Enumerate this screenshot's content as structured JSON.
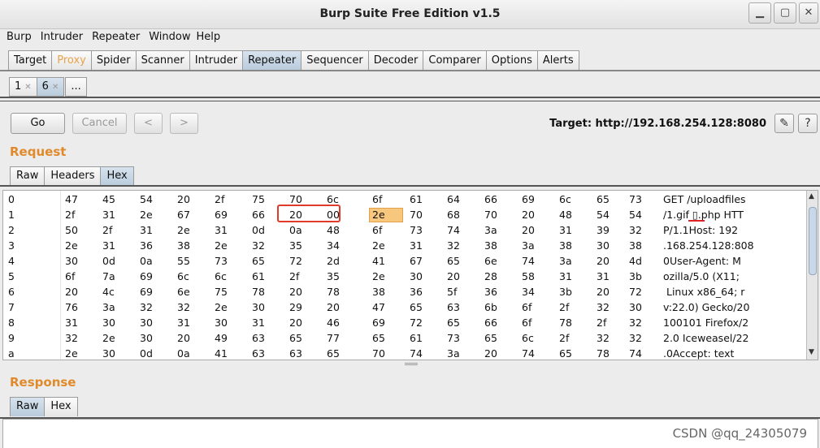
{
  "window": {
    "title": "Burp Suite Free Edition v1.5"
  },
  "menu": [
    "Burp",
    "Intruder",
    "Repeater",
    "Window",
    "Help"
  ],
  "main_tabs": [
    "Target",
    "Proxy",
    "Spider",
    "Scanner",
    "Intruder",
    "Repeater",
    "Sequencer",
    "Decoder",
    "Comparer",
    "Options",
    "Alerts"
  ],
  "sub_tabs": {
    "tab1": "1",
    "tab2": "6",
    "more": "..."
  },
  "toolbar": {
    "go": "Go",
    "cancel": "Cancel",
    "prev": "<",
    "next": ">",
    "target": "Target: http://192.168.254.128:8080",
    "help": "?"
  },
  "request": {
    "title": "Request",
    "view_tabs": [
      "Raw",
      "Headers",
      "Hex"
    ],
    "rows": [
      {
        "offset": "0",
        "hex": [
          "47",
          "45",
          "54",
          "20",
          "2f",
          "75",
          "70",
          "6c",
          "6f",
          "61",
          "64",
          "66",
          "69",
          "6c",
          "65",
          "73"
        ],
        "ascii": "GET /uploadfiles"
      },
      {
        "offset": "1",
        "hex": [
          "2f",
          "31",
          "2e",
          "67",
          "69",
          "66",
          "20",
          "00",
          "2e",
          "70",
          "68",
          "70",
          "20",
          "48",
          "54",
          "54"
        ],
        "ascii": "/1.gif ▯.php HTT"
      },
      {
        "offset": "2",
        "hex": [
          "50",
          "2f",
          "31",
          "2e",
          "31",
          "0d",
          "0a",
          "48",
          "6f",
          "73",
          "74",
          "3a",
          "20",
          "31",
          "39",
          "32"
        ],
        "ascii": "P/1.1Host: 192"
      },
      {
        "offset": "3",
        "hex": [
          "2e",
          "31",
          "36",
          "38",
          "2e",
          "32",
          "35",
          "34",
          "2e",
          "31",
          "32",
          "38",
          "3a",
          "38",
          "30",
          "38"
        ],
        "ascii": ".168.254.128:808"
      },
      {
        "offset": "4",
        "hex": [
          "30",
          "0d",
          "0a",
          "55",
          "73",
          "65",
          "72",
          "2d",
          "41",
          "67",
          "65",
          "6e",
          "74",
          "3a",
          "20",
          "4d"
        ],
        "ascii": "0User-Agent: M"
      },
      {
        "offset": "5",
        "hex": [
          "6f",
          "7a",
          "69",
          "6c",
          "6c",
          "61",
          "2f",
          "35",
          "2e",
          "30",
          "20",
          "28",
          "58",
          "31",
          "31",
          "3b"
        ],
        "ascii": "ozilla/5.0 (X11;"
      },
      {
        "offset": "6",
        "hex": [
          "20",
          "4c",
          "69",
          "6e",
          "75",
          "78",
          "20",
          "78",
          "38",
          "36",
          "5f",
          "36",
          "34",
          "3b",
          "20",
          "72"
        ],
        "ascii": " Linux x86_64; r"
      },
      {
        "offset": "7",
        "hex": [
          "76",
          "3a",
          "32",
          "32",
          "2e",
          "30",
          "29",
          "20",
          "47",
          "65",
          "63",
          "6b",
          "6f",
          "2f",
          "32",
          "30"
        ],
        "ascii": "v:22.0) Gecko/20"
      },
      {
        "offset": "8",
        "hex": [
          "31",
          "30",
          "30",
          "31",
          "30",
          "31",
          "20",
          "46",
          "69",
          "72",
          "65",
          "66",
          "6f",
          "78",
          "2f",
          "32"
        ],
        "ascii": "100101 Firefox/2"
      },
      {
        "offset": "9",
        "hex": [
          "32",
          "2e",
          "30",
          "20",
          "49",
          "63",
          "65",
          "77",
          "65",
          "61",
          "73",
          "65",
          "6c",
          "2f",
          "32",
          "32"
        ],
        "ascii": "2.0 Iceweasel/22"
      },
      {
        "offset": "a",
        "hex": [
          "2e",
          "30",
          "0d",
          "0a",
          "41",
          "63",
          "63",
          "65",
          "70",
          "74",
          "3a",
          "20",
          "74",
          "65",
          "78",
          "74"
        ],
        "ascii": ".0Accept: text"
      }
    ]
  },
  "response": {
    "title": "Response",
    "view_tabs": [
      "Raw",
      "Hex"
    ]
  },
  "watermark": "CSDN @qq_24305079",
  "colors": {
    "accent_orange": "#e08a2b",
    "selected_tab": "#b9cbdc",
    "hex_highlight": "#f7c77e",
    "annotation_red": "#e23a2a"
  }
}
